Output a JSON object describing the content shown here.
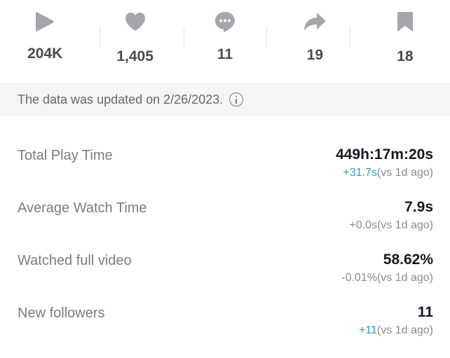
{
  "stats": [
    {
      "icon": "play-icon",
      "count": "204K"
    },
    {
      "icon": "heart-icon",
      "count": "1,405"
    },
    {
      "icon": "comment-icon",
      "count": "11"
    },
    {
      "icon": "share-icon",
      "count": "19"
    },
    {
      "icon": "bookmark-icon",
      "count": "18"
    }
  ],
  "notice": {
    "text": "The data was updated on 2/26/2023.",
    "icon": "info-icon"
  },
  "metrics": [
    {
      "label": "Total Play Time",
      "value": "449h:17m:20s",
      "delta": "+31.7s",
      "comparison": "(vs 1d ago)",
      "trend": "up"
    },
    {
      "label": "Average Watch Time",
      "value": "7.9s",
      "delta": "+0.0s",
      "comparison": "(vs 1d ago)",
      "trend": "flat"
    },
    {
      "label": "Watched full video",
      "value": "58.62%",
      "delta": "-0.01%",
      "comparison": "(vs 1d ago)",
      "trend": "flat"
    },
    {
      "label": "New followers",
      "value": "11",
      "delta": "+11",
      "comparison": "(vs 1d ago)",
      "trend": "up"
    }
  ],
  "colors": {
    "icon_gray": "#a5a6ab",
    "positive_delta": "#2a9dbe",
    "notice_background": "#f5f5f6"
  }
}
